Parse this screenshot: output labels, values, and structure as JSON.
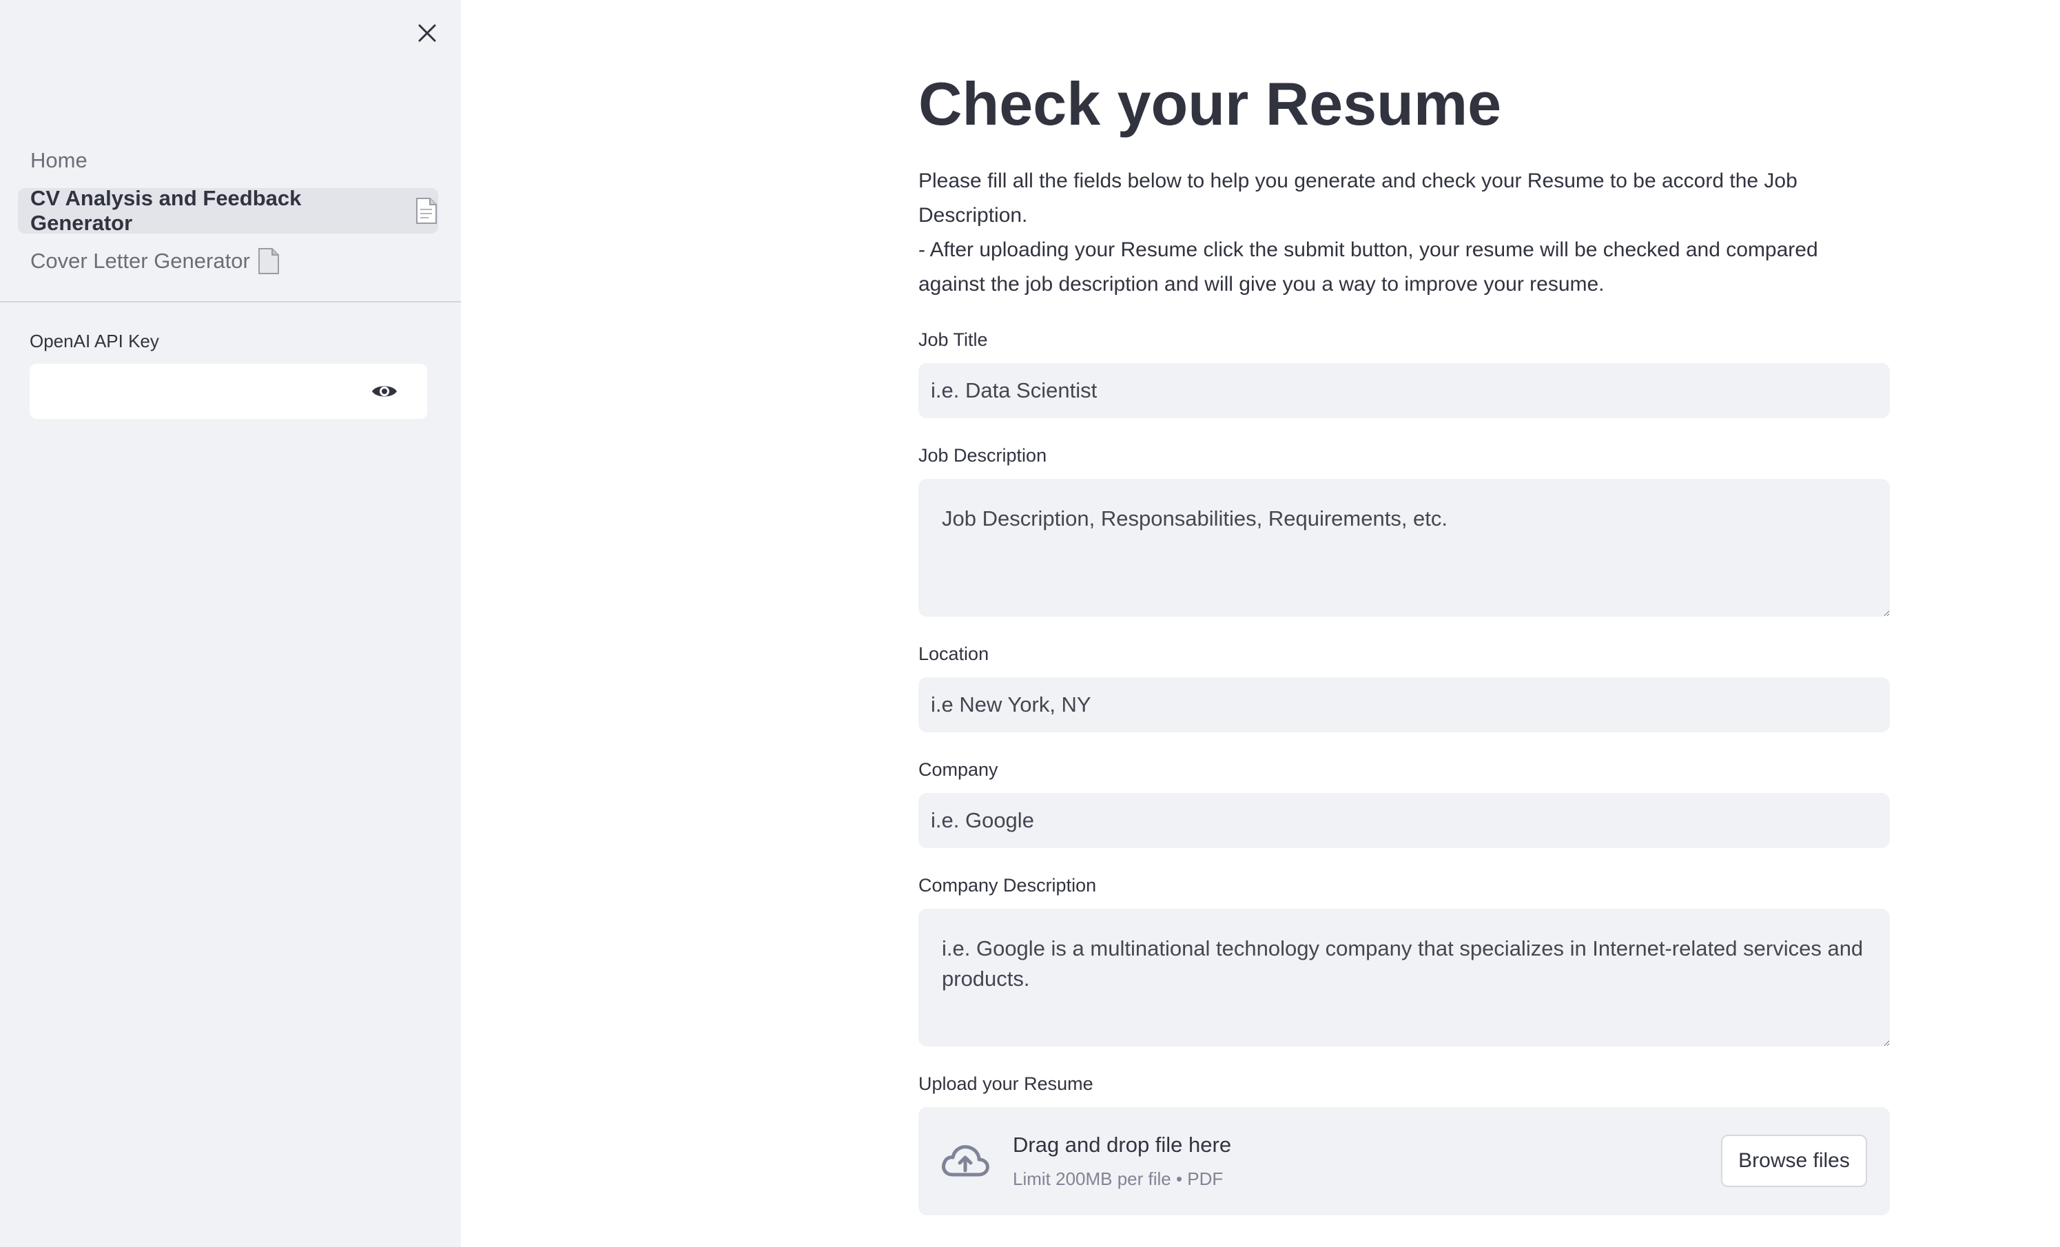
{
  "sidebar": {
    "close_icon": "close-icon",
    "nav": [
      {
        "label": "Home",
        "icon": ""
      },
      {
        "label": "CV Analysis and Feedback Generator",
        "icon": "document-icon"
      },
      {
        "label": "Cover Letter Generator",
        "icon": "document-icon"
      }
    ],
    "active_index": 1,
    "api_key": {
      "label": "OpenAI API Key",
      "value": "",
      "toggle_icon": "eye-icon"
    }
  },
  "main": {
    "title": "Check your Resume",
    "intro_line1": "Please fill all the fields below to help you generate and check your Resume to be accord the Job Description.",
    "intro_line2": "- After uploading your Resume click the submit button, your resume will be checked and compared against the job description and will give you a way to improve your resume.",
    "fields": {
      "job_title": {
        "label": "Job Title",
        "placeholder": "i.e. Data Scientist"
      },
      "job_description": {
        "label": "Job Description",
        "placeholder": "Job Description, Responsabilities, Requirements, etc."
      },
      "location": {
        "label": "Location",
        "placeholder": "i.e New York, NY"
      },
      "company": {
        "label": "Company",
        "placeholder": "i.e. Google"
      },
      "company_description": {
        "label": "Company Description",
        "placeholder": "i.e. Google is a multinational technology company that specializes in Internet-related services and products."
      }
    },
    "upload": {
      "label": "Upload your Resume",
      "drop_title": "Drag and drop file here",
      "drop_sub": "Limit 200MB per file • PDF",
      "browse_label": "Browse files",
      "icon": "cloud-upload-icon"
    }
  },
  "colors": {
    "sidebar_bg": "#f0f2f6",
    "input_bg": "#f0f2f6",
    "text": "#31333f",
    "muted_text": "#808495"
  }
}
